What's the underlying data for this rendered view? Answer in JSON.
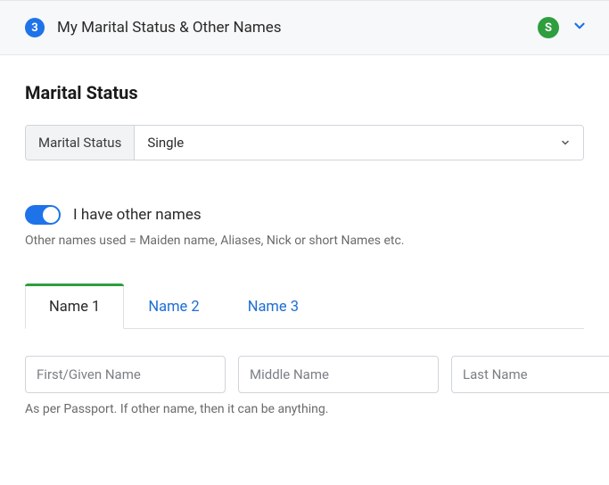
{
  "header": {
    "step": "3",
    "title": "My Marital Status & Other Names",
    "status_letter": "S"
  },
  "marital": {
    "section_title": "Marital Status",
    "label": "Marital Status",
    "value": "Single"
  },
  "other_names": {
    "toggle_label": "I have other names",
    "helper": "Other names used = Maiden name, Aliases, Nick or short Names etc.",
    "tabs": [
      {
        "label": "Name 1"
      },
      {
        "label": "Name 2"
      },
      {
        "label": "Name 3"
      }
    ],
    "placeholders": {
      "first": "First/Given Name",
      "middle": "Middle Name",
      "last": "Last Name"
    },
    "hint": "As per Passport. If other name, then it can be anything."
  }
}
